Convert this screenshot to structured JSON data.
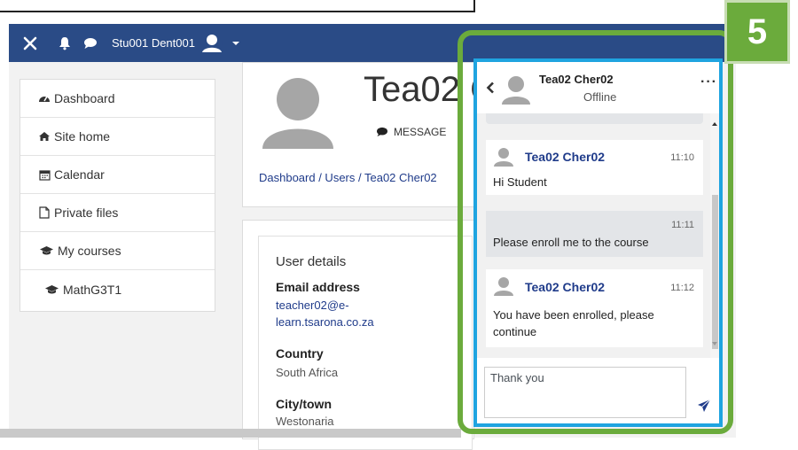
{
  "navbar": {
    "username": "Stu001 Dent001"
  },
  "sidebar": {
    "items": [
      {
        "label": "Dashboard",
        "icon": "dashboard-icon"
      },
      {
        "label": "Site home",
        "icon": "home-icon"
      },
      {
        "label": "Calendar",
        "icon": "calendar-icon"
      },
      {
        "label": "Private files",
        "icon": "file-icon"
      },
      {
        "label": "My courses",
        "icon": "graduation-cap-icon"
      },
      {
        "label": "MathG3T1",
        "icon": "graduation-cap-icon"
      }
    ]
  },
  "profile": {
    "name": "Tea02 C",
    "message_label": "MESSAGE",
    "breadcrumb": "Dashboard / Users / Tea02 Cher02"
  },
  "details": {
    "heading": "User details",
    "email_label": "Email address",
    "email_line1": "teacher02@e-",
    "email_line2": "learn.tsarona.co.za",
    "country_label": "Country",
    "country_value": "South Africa",
    "city_label": "City/town",
    "city_value": "Westonaria"
  },
  "chat": {
    "contact_name": "Tea02 Cher02",
    "status": "Offline",
    "messages": [
      {
        "direction": "in",
        "sender": "Tea02 Cher02",
        "time": "11:10",
        "text": "Hi Student"
      },
      {
        "direction": "out",
        "sender": "",
        "time": "11:11",
        "text": "Please enroll me to the course"
      },
      {
        "direction": "in",
        "sender": "Tea02 Cher02",
        "time": "11:12",
        "text_line1": "You have been enrolled, please",
        "text_line2": "continue"
      }
    ],
    "input_value": "Thank you"
  },
  "annotation": {
    "step_number": "5"
  },
  "colors": {
    "navbar": "#2a4b86",
    "frame_green": "#6bab3c",
    "chat_border_blue": "#1fa4e0"
  }
}
